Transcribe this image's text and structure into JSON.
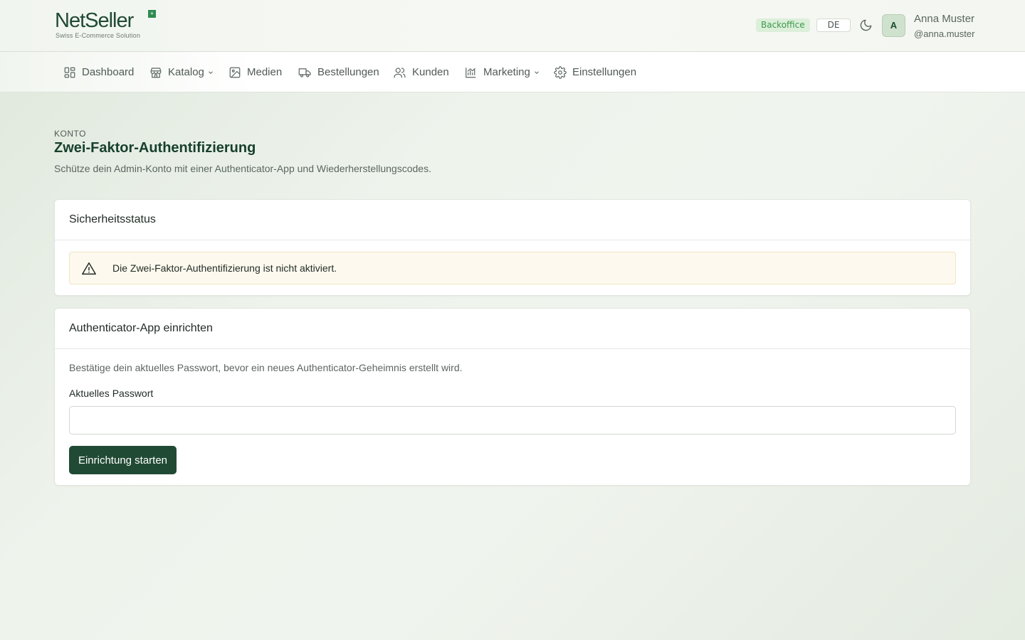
{
  "header": {
    "logo": {
      "brand": "NetSeller",
      "tagline": "Swiss E-Commerce Solution"
    },
    "badge": "Backoffice",
    "language": "DE",
    "theme_toggle_icon": "moon-icon",
    "user": {
      "initial": "A",
      "name": "Anna Muster",
      "handle": "@anna.muster"
    }
  },
  "nav": {
    "items": [
      {
        "label": "Dashboard",
        "icon": "dashboard-icon"
      },
      {
        "label": "Katalog",
        "icon": "store-icon",
        "dropdown": true
      },
      {
        "label": "Medien",
        "icon": "image-icon"
      },
      {
        "label": "Bestellungen",
        "icon": "truck-icon"
      },
      {
        "label": "Kunden",
        "icon": "users-icon"
      },
      {
        "label": "Marketing",
        "icon": "chart-icon",
        "dropdown": true
      },
      {
        "label": "Einstellungen",
        "icon": "gear-icon"
      }
    ]
  },
  "page": {
    "eyebrow": "KONTO",
    "title": "Zwei-Faktor-Authentifizierung",
    "subtitle": "Schütze dein Admin-Konto mit einer Authenticator-App und Wiederherstellungscodes."
  },
  "status_card": {
    "title": "Sicherheitsstatus",
    "alert_text": "Die Zwei-Faktor-Authentifizierung ist nicht aktiviert."
  },
  "setup_card": {
    "title": "Authenticator-App einrichten",
    "help_text": "Bestätige dein aktuelles Passwort, bevor ein neues Authenticator-Geheimnis erstellt wird.",
    "password_label": "Aktuelles Passwort",
    "password_value": "",
    "submit_label": "Einrichtung starten"
  },
  "colors": {
    "brand": "#1f4a33",
    "primary_button": "#214a34",
    "badge_bg": "#dcefd9",
    "badge_text": "#3a9a4d",
    "alert_bg": "#fdf9ee",
    "alert_border": "#f1e4c2"
  }
}
